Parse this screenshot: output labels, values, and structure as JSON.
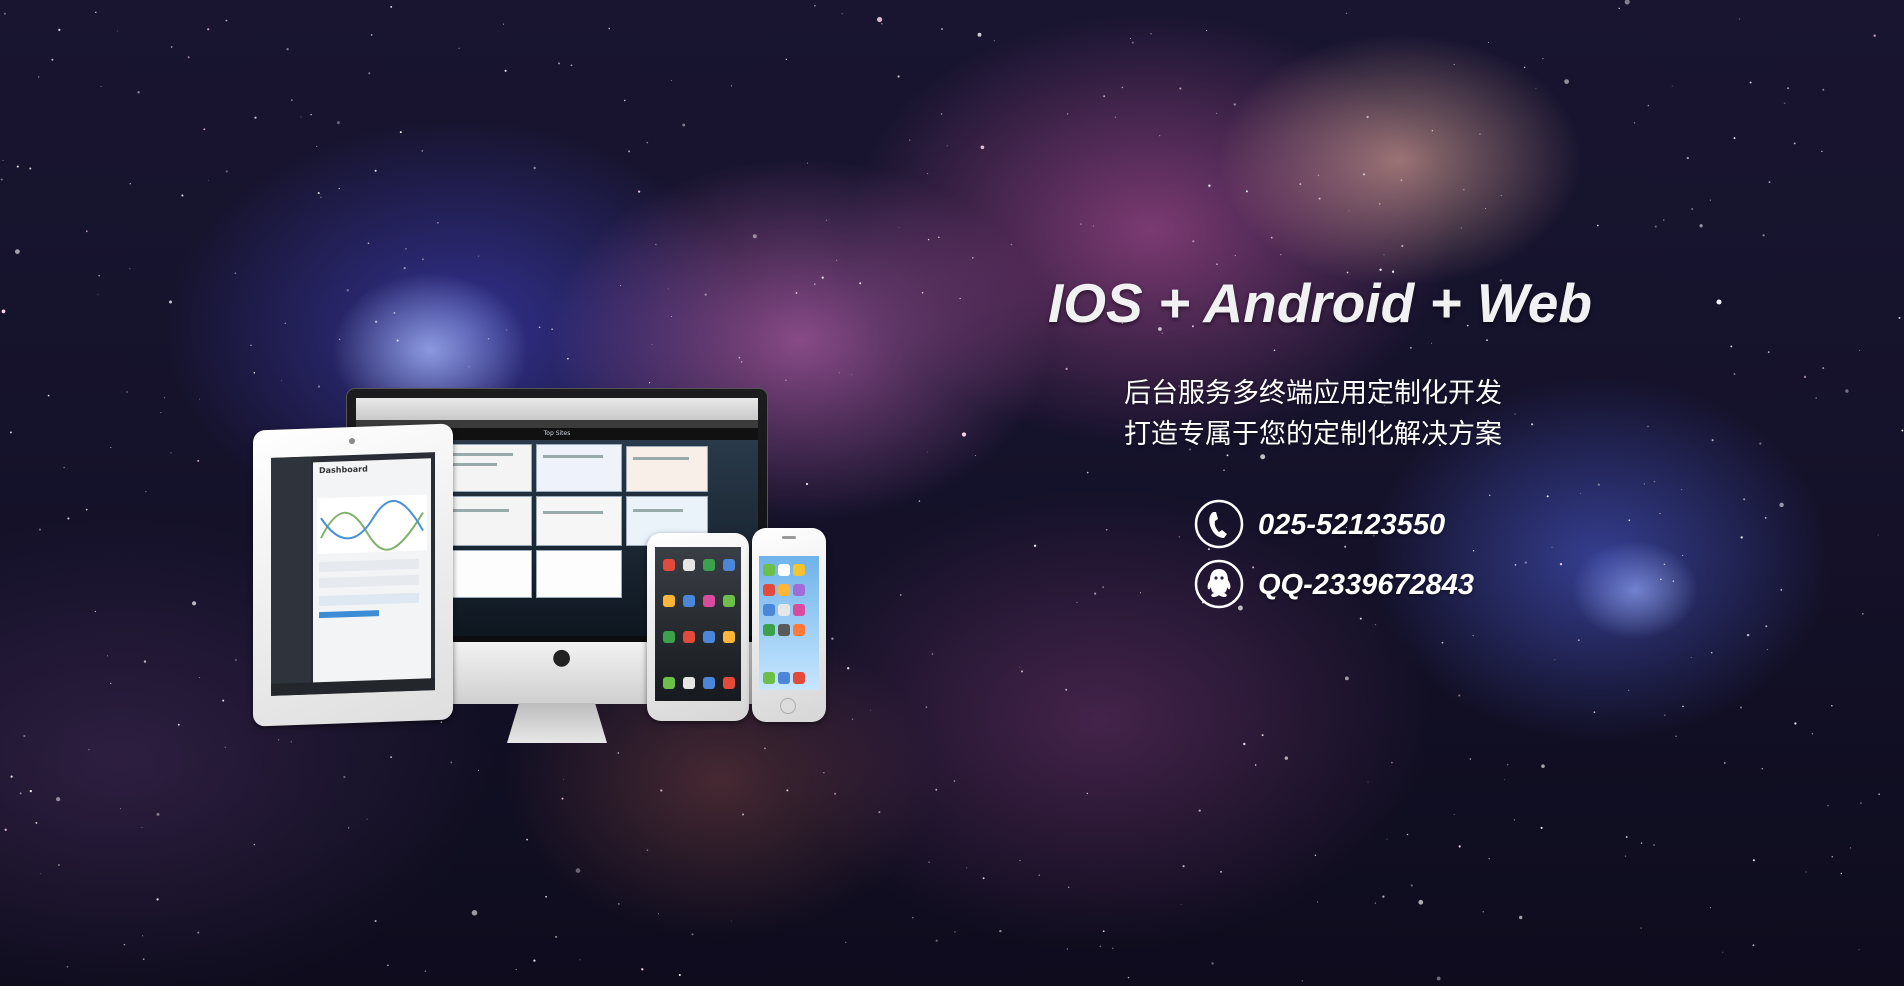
{
  "banner": {
    "headline": "IOS + Android + Web",
    "subline_1": "后台服务多终端应用定制化开发",
    "subline_2": "打造专属于您的定制化解决方案"
  },
  "contacts": [
    {
      "icon": "phone-icon",
      "text": "025-52123550"
    },
    {
      "icon": "qq-icon",
      "text": "QQ-2339672843"
    }
  ],
  "devices": {
    "ipad_screen_title": "Dashboard",
    "imac_screen_title": "Top Sites"
  },
  "colors": {
    "text": "#ffffff",
    "nebula_pink": "#cd5aaa",
    "nebula_blue": "#4646d2",
    "space": "#15122b"
  }
}
